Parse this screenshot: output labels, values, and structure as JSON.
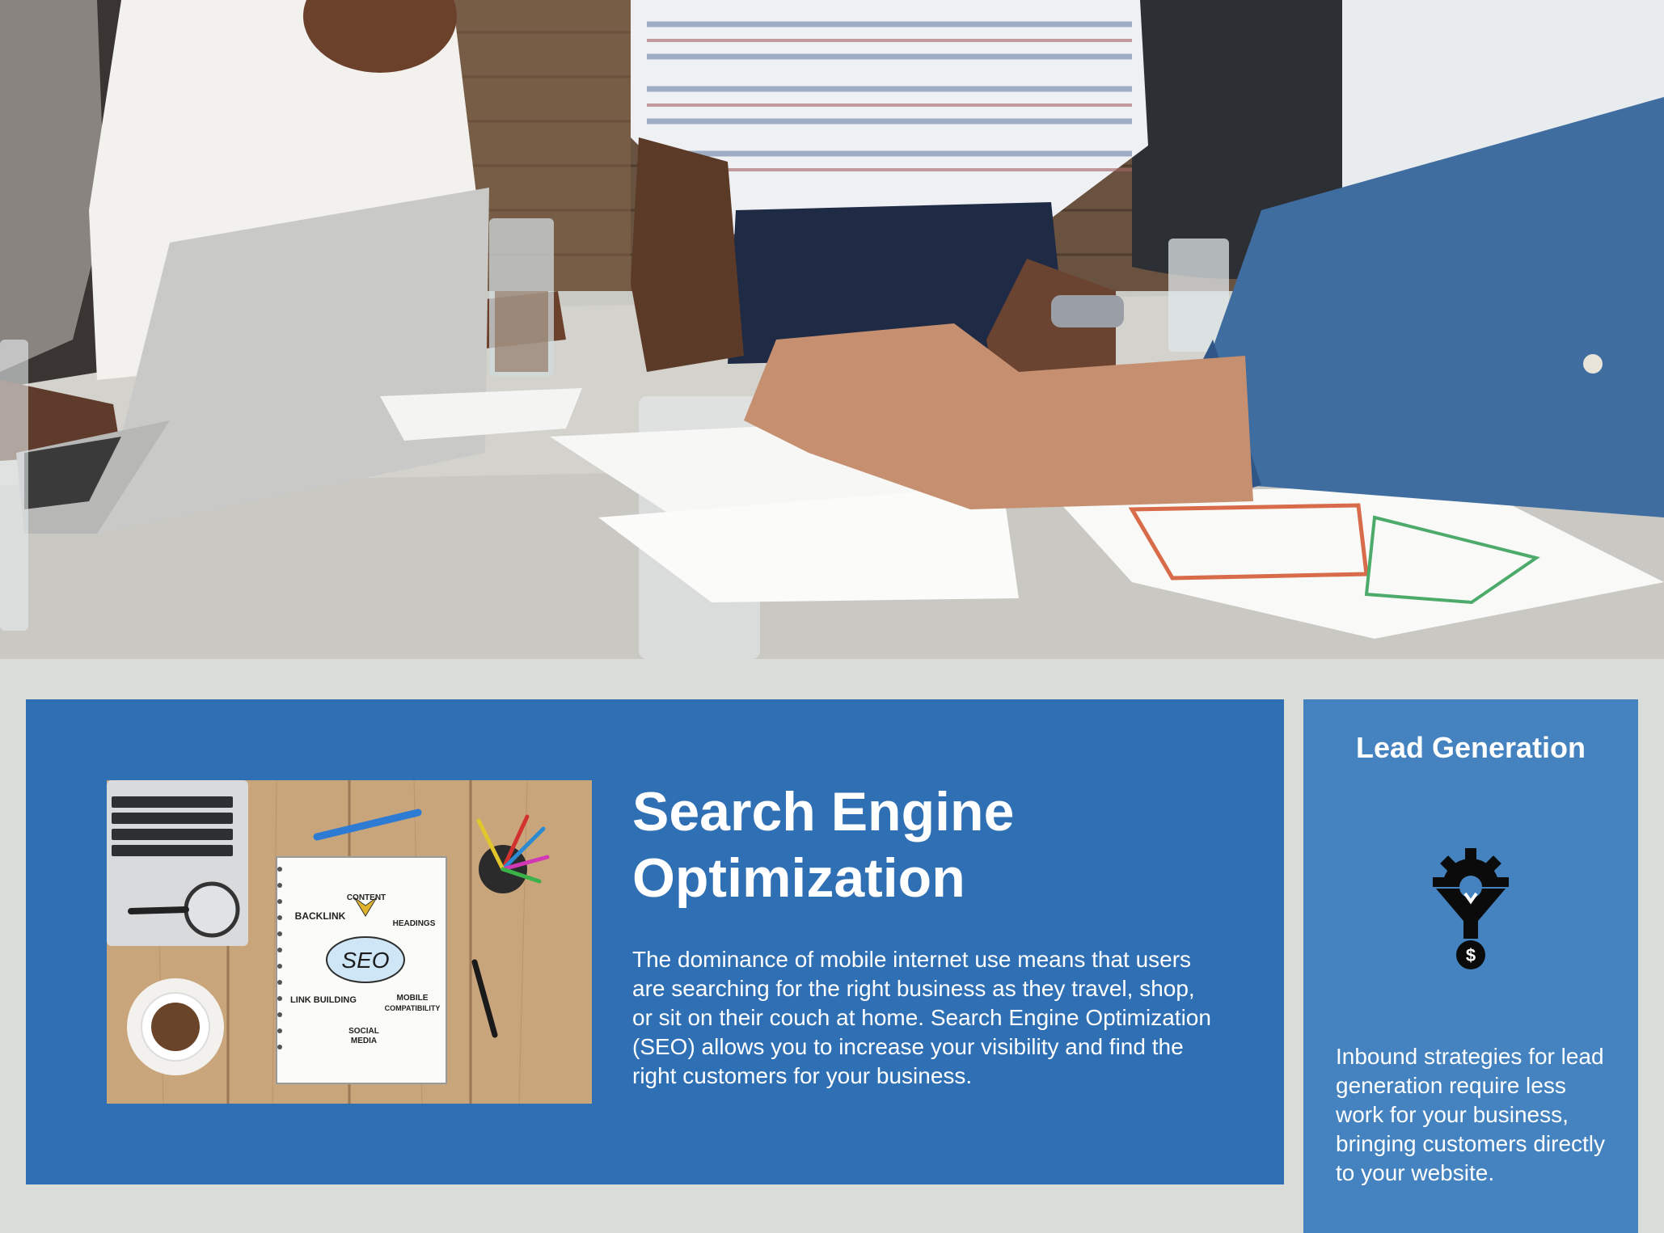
{
  "hero": {
    "icon": "team-meeting-photo"
  },
  "seo": {
    "title": "Search Engine Optimization",
    "body": "The dominance of mobile internet use means that users are searching for the right business as they travel, shop, or sit on their couch at home. Search Engine Optimization (SEO) allows you to increase your visibility and find the right customers for your business.",
    "thumbnail": {
      "center_word": "SEO",
      "labels": {
        "content": "CONTENT",
        "headings": "HEADINGS",
        "backlink": "BACKLINK",
        "link_building": "LINK BUILDING",
        "mobile": "MOBILE",
        "compatibility": "COMPATIBILITY",
        "social": "SOCIAL",
        "media": "MEDIA"
      }
    }
  },
  "lead": {
    "title": "Lead Generation",
    "icon": "funnel-gear-dollar-icon",
    "dollar": "$",
    "body": "Inbound strategies for lead generation require less work for your business, bringing customers directly to your website."
  },
  "colors": {
    "page_bg": "#dadcd7",
    "seo_card": "#2f6fb4",
    "lead_card": "#4483bf",
    "text": "#ffffff"
  }
}
